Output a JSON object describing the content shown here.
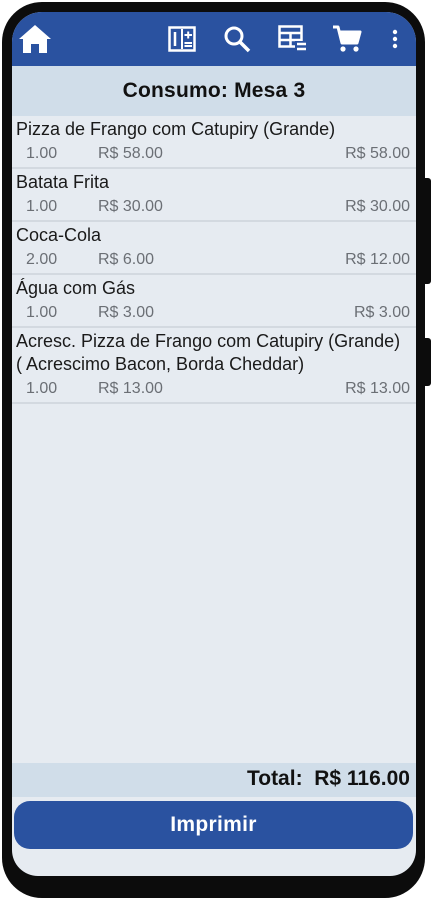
{
  "colors": {
    "appbar": "#2a52a0",
    "header_bg": "#d0dde9",
    "screen_bg": "#e6ebf1",
    "button_bg": "#2a52a0"
  },
  "appbar": {
    "icons": [
      "home-icon",
      "calculator-icon",
      "search-icon",
      "table-grid-icon",
      "cart-icon",
      "more-vert-icon"
    ]
  },
  "header": {
    "title": "Consumo: Mesa 3"
  },
  "items": [
    {
      "name": "Pizza de Frango com Catupiry  (Grande)",
      "qty": "1.00",
      "unit_price": "R$ 58.00",
      "total": "R$ 58.00"
    },
    {
      "name": "Batata Frita",
      "qty": "1.00",
      "unit_price": "R$ 30.00",
      "total": "R$ 30.00"
    },
    {
      "name": "Coca-Cola",
      "qty": "2.00",
      "unit_price": "R$ 6.00",
      "total": "R$ 12.00"
    },
    {
      "name": "Água com Gás",
      "qty": "1.00",
      "unit_price": "R$ 3.00",
      "total": "R$ 3.00"
    },
    {
      "name": "Acresc.  Pizza de Frango com Catupiry (Grande) ( Acrescimo Bacon, Borda Cheddar)",
      "qty": "1.00",
      "unit_price": "R$ 13.00",
      "total": "R$ 13.00"
    }
  ],
  "footer": {
    "total_label": "Total:  R$ 116.00",
    "print_label": "Imprimir"
  }
}
